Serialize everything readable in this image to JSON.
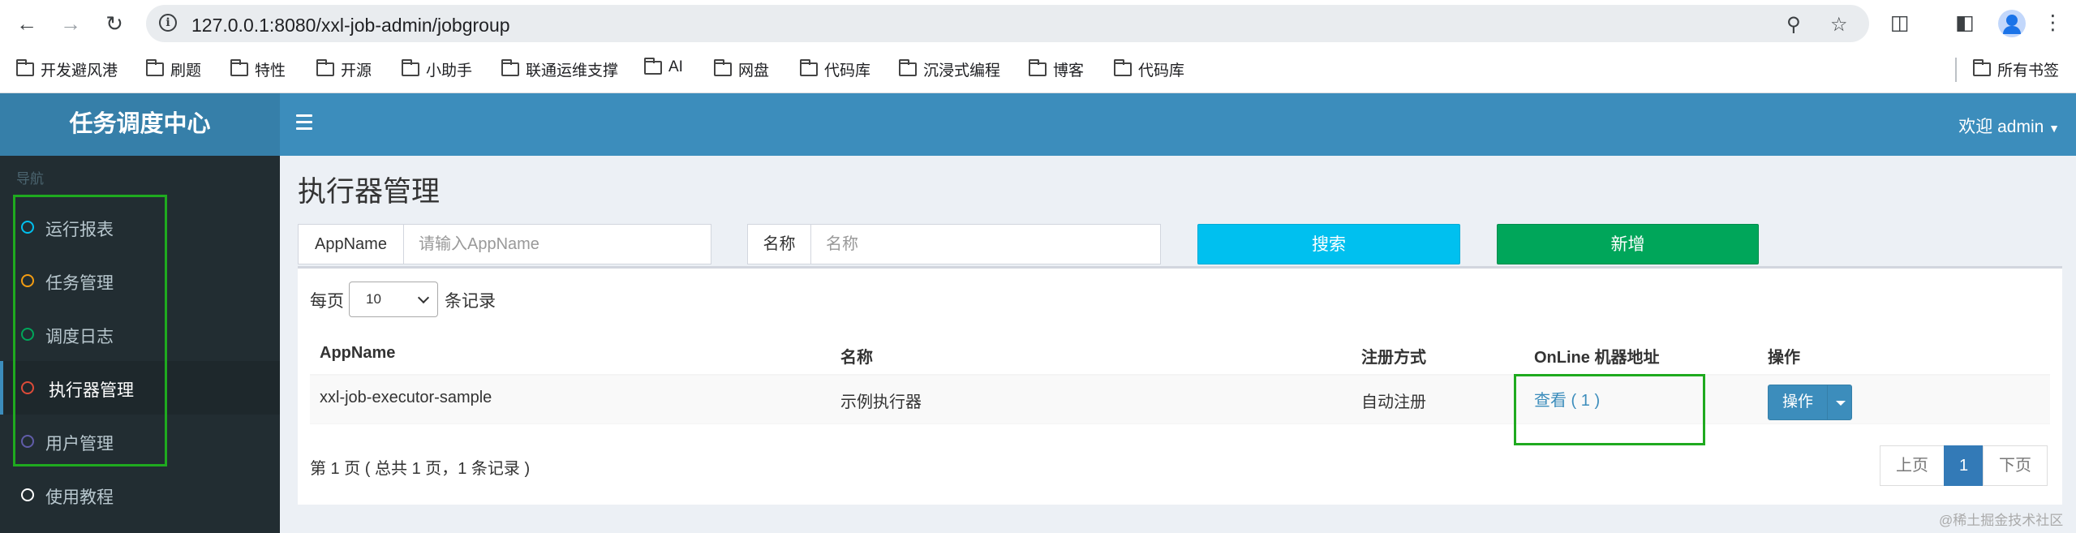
{
  "browser": {
    "url": "127.0.0.1:8080/xxl-job-admin/jobgroup",
    "bookmarks": [
      "开发避风港",
      "刷题",
      "特性",
      "开源",
      "小助手",
      "联通运维支撑",
      "AI",
      "网盘",
      "代码库",
      "沉浸式编程",
      "博客",
      "代码库"
    ],
    "all_bookmarks": "所有书签"
  },
  "app": {
    "logo": "任务调度中心",
    "user_menu": "欢迎 admin"
  },
  "sidebar": {
    "header": "导航",
    "items": [
      {
        "label": "运行报表",
        "color": "#00c0ef"
      },
      {
        "label": "任务管理",
        "color": "#f39c12"
      },
      {
        "label": "调度日志",
        "color": "#00a65a"
      },
      {
        "label": "执行器管理",
        "color": "#dd4b39"
      },
      {
        "label": "用户管理",
        "color": "#605ca8"
      },
      {
        "label": "使用教程",
        "color": "#ffffff"
      }
    ],
    "active_item": "执行器管理"
  },
  "page": {
    "title": "执行器管理",
    "filter": {
      "appname_label": "AppName",
      "appname_placeholder": "请输入AppName",
      "name_label": "名称",
      "name_placeholder": "名称",
      "search_button": "搜索",
      "add_button": "新增"
    },
    "length": {
      "prefix": "每页",
      "value": "10",
      "suffix": "条记录"
    },
    "table": {
      "columns": [
        "AppName",
        "名称",
        "注册方式",
        "OnLine 机器地址",
        "操作"
      ],
      "rows": [
        {
          "appname": "xxl-job-executor-sample",
          "name": "示例执行器",
          "register": "自动注册",
          "online": "查看 ( 1 )",
          "action": "操作"
        }
      ]
    },
    "info": "第 1 页 ( 总共 1 页，1 条记录 )",
    "pager": {
      "prev": "上页",
      "current": "1",
      "next": "下页"
    }
  },
  "watermark": "@稀土掘金技术社区",
  "colors": {
    "highlight": "#1faa1f",
    "header": "#3c8dbc",
    "sidebar": "#222d32"
  }
}
